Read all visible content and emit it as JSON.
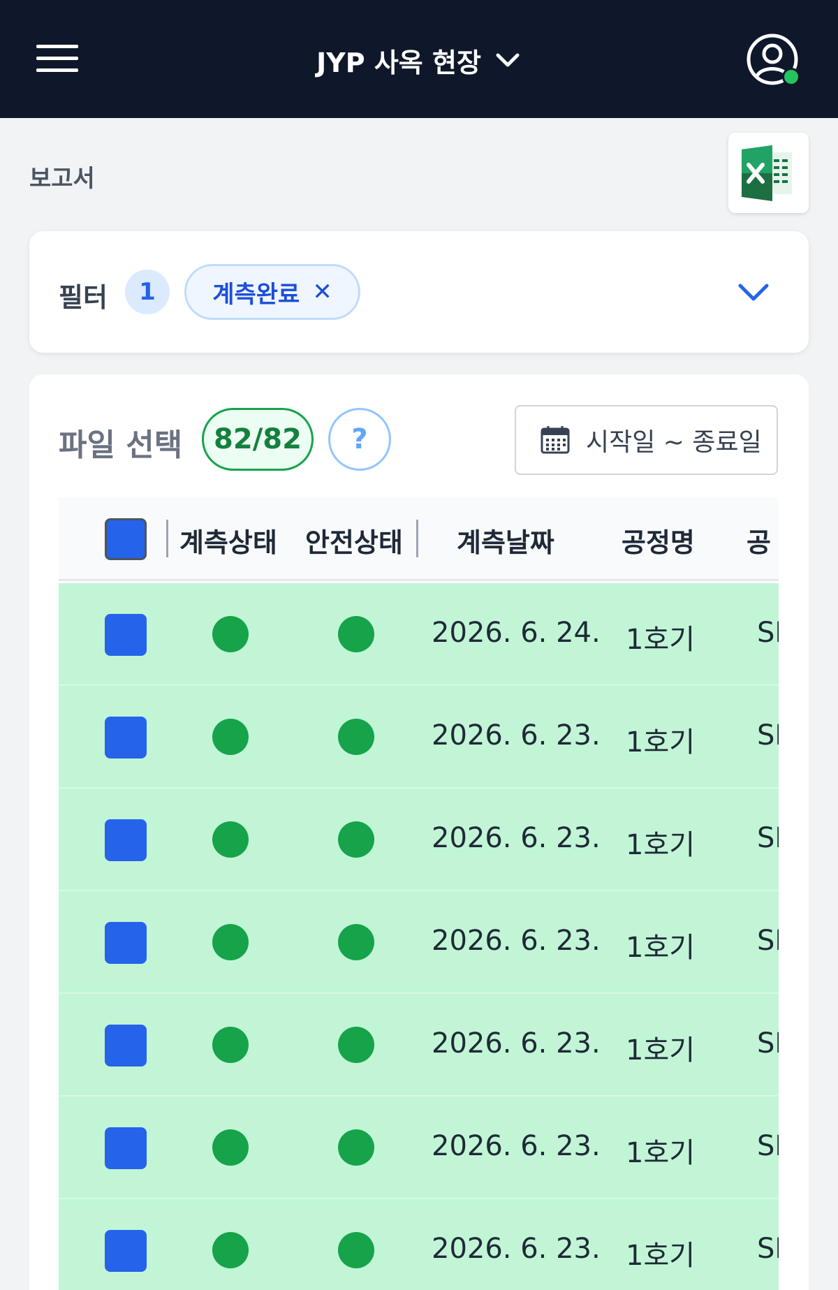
{
  "header": {
    "site_name": "JYP 사옥 현장",
    "icons": {
      "menu": "hamburger-icon",
      "dropdown": "chevron-down-icon",
      "profile": "user-circle-icon",
      "status": "online-status-dot"
    },
    "colors": {
      "background": "#0f172a",
      "status": "#22c55e"
    }
  },
  "page": {
    "title": "보고서",
    "excel_icon": "excel-icon"
  },
  "filter": {
    "label": "필터",
    "count": "1",
    "chips": [
      {
        "label": "계측완료",
        "remove_icon": "close-icon"
      }
    ],
    "toggle_icon": "chevron-down-icon"
  },
  "files": {
    "title": "파일 선택",
    "selected_count": "82/82",
    "help_label": "?",
    "date_range_placeholder": "시작일 ~ 종료일",
    "calendar_icon": "calendar-icon"
  },
  "table": {
    "columns": [
      "계측상태",
      "안전상태",
      "계측날짜",
      "공정명",
      "공"
    ],
    "status_color": "#16a34a",
    "row_color": "#c1f5d6",
    "rows": [
      {
        "date": "2026. 6. 24.",
        "process": "1호기",
        "extra": "SI"
      },
      {
        "date": "2026. 6. 23.",
        "process": "1호기",
        "extra": "SI"
      },
      {
        "date": "2026. 6. 23.",
        "process": "1호기",
        "extra": "SI"
      },
      {
        "date": "2026. 6. 23.",
        "process": "1호기",
        "extra": "SI"
      },
      {
        "date": "2026. 6. 23.",
        "process": "1호기",
        "extra": "SI"
      },
      {
        "date": "2026. 6. 23.",
        "process": "1호기",
        "extra": "SI"
      },
      {
        "date": "2026. 6. 23.",
        "process": "1호기",
        "extra": "SI"
      }
    ]
  }
}
